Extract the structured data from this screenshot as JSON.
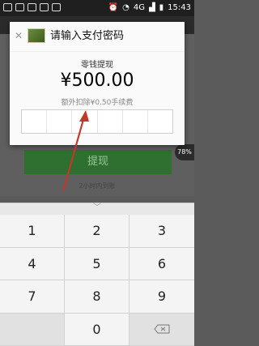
{
  "status_bar": {
    "time": "15:43",
    "network": "4G"
  },
  "background": {
    "button_label": "提现",
    "note": "2小时内到账",
    "float_badge": "78%"
  },
  "dialog": {
    "title": "请输入支付密码",
    "subtitle": "零钱提现",
    "amount": "¥500.00",
    "fee": "额外扣除¥0.50手续费"
  },
  "keypad": {
    "keys": [
      "1",
      "2",
      "3",
      "4",
      "5",
      "6",
      "7",
      "8",
      "9",
      "",
      "0",
      "delete"
    ]
  },
  "colors": {
    "accent_green": "#2f6f2f",
    "annotation_red": "#c0392b"
  }
}
